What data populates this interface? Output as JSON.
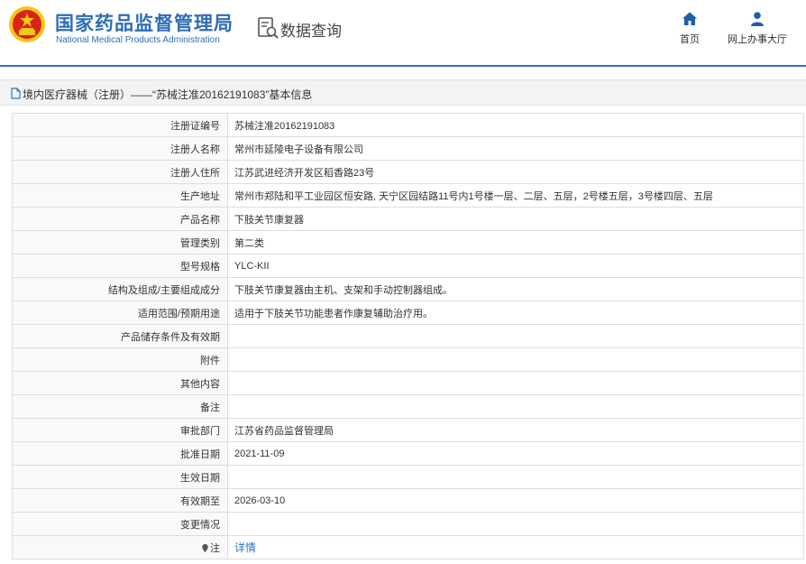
{
  "header": {
    "brand_cn": "国家药品监督管理局",
    "brand_en": "National Medical Products Administration",
    "query_label": "数据查询",
    "nav": [
      {
        "label": "首页",
        "icon": "home-icon"
      },
      {
        "label": "网上办事大厅",
        "icon": "user-icon"
      }
    ]
  },
  "breadcrumb": {
    "text": "境内医疗器械（注册）——“苏械注准20162191083”基本信息",
    "icon": "document-icon"
  },
  "colors": {
    "brand_blue": "#2d6db6",
    "accent_line": "#2a76c6",
    "emblem_red": "#d8231a",
    "emblem_gold": "#f5c518",
    "link": "#2a76c6"
  },
  "rows": [
    {
      "label": "注册证编号",
      "value": "苏械注准20162191083"
    },
    {
      "label": "注册人名称",
      "value": "常州市延陵电子设备有限公司"
    },
    {
      "label": "注册人住所",
      "value": "江苏武进经济开发区稻香路23号"
    },
    {
      "label": "生产地址",
      "value": "常州市郑陆和平工业园区恒安路, 天宁区园结路11号内1号楼一层、二层、五层，2号楼五层，3号楼四层、五层"
    },
    {
      "label": "产品名称",
      "value": "下肢关节康复器"
    },
    {
      "label": "管理类别",
      "value": "第二类"
    },
    {
      "label": "型号规格",
      "value": "YLC-KII"
    },
    {
      "label": "结构及组成/主要组成成分",
      "value": "下肢关节康复器由主机、支架和手动控制器组成。"
    },
    {
      "label": "适用范围/预期用途",
      "value": "适用于下肢关节功能患者作康复辅助治疗用。"
    },
    {
      "label": "产品储存条件及有效期",
      "value": ""
    },
    {
      "label": "附件",
      "value": ""
    },
    {
      "label": "其他内容",
      "value": ""
    },
    {
      "label": "备注",
      "value": ""
    },
    {
      "label": "审批部门",
      "value": "江苏省药品监督管理局"
    },
    {
      "label": "批准日期",
      "value": "2021-11-09"
    },
    {
      "label": "生效日期",
      "value": ""
    },
    {
      "label": "有效期至",
      "value": "2026-03-10"
    },
    {
      "label": "变更情况",
      "value": ""
    }
  ],
  "note_row": {
    "label": "注",
    "link_text": "详情",
    "icon": "pin-icon"
  }
}
